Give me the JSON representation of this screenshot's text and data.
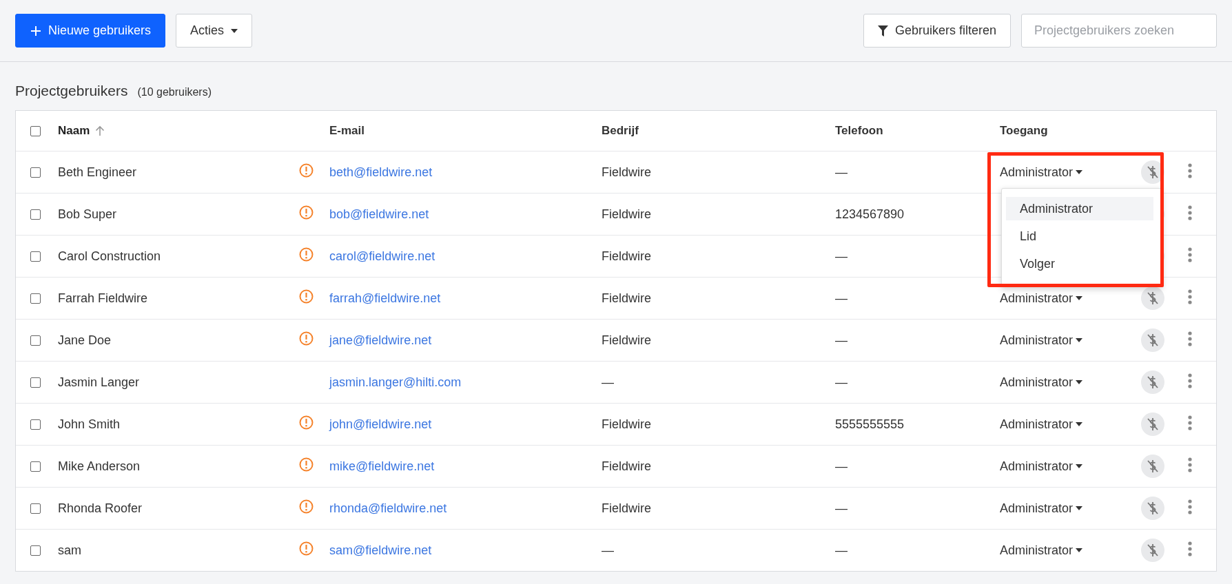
{
  "toolbar": {
    "new_button": "Nieuwe gebruikers",
    "actions_button": "Acties",
    "filter_button": "Gebruikers filteren",
    "search": {
      "placeholder": "Projectgebruikers zoeken"
    }
  },
  "heading": {
    "title": "Projectgebruikers",
    "count": "(10 gebruikers)"
  },
  "table": {
    "select_all": {
      "checked": false
    },
    "columns": [
      {
        "label": "Naam",
        "sorted": true
      },
      {
        "label": "E-mail",
        "sorted": false
      },
      {
        "label": "Bedrijf",
        "sorted": false
      },
      {
        "label": "Telefoon",
        "sorted": false
      },
      {
        "label": "Toegang",
        "sorted": false
      }
    ],
    "rows": [
      {
        "checked": false,
        "name": "Beth Engineer",
        "warning": true,
        "email": "beth@fieldwire.net",
        "company": "Fieldwire",
        "phone": "—",
        "access": "Administrator",
        "access_menu": [
          {
            "label": "Administrator",
            "selected": true
          },
          {
            "label": "Lid",
            "selected": false
          },
          {
            "label": "Volger",
            "selected": false
          }
        ]
      },
      {
        "checked": false,
        "name": "Bob Super",
        "warning": true,
        "email": "bob@fieldwire.net",
        "company": "Fieldwire",
        "phone": "1234567890"
      },
      {
        "checked": false,
        "name": "Carol Construction",
        "warning": true,
        "email": "carol@fieldwire.net",
        "company": "Fieldwire",
        "phone": "—"
      },
      {
        "checked": false,
        "name": "Farrah Fieldwire",
        "warning": true,
        "email": "farrah@fieldwire.net",
        "company": "Fieldwire",
        "phone": "—",
        "access": "Administrator"
      },
      {
        "checked": false,
        "name": "Jane Doe",
        "warning": true,
        "email": "jane@fieldwire.net",
        "company": "Fieldwire",
        "phone": "—",
        "access": "Administrator"
      },
      {
        "checked": false,
        "name": "Jasmin Langer",
        "warning": false,
        "email": "jasmin.langer@hilti.com",
        "company": "—",
        "phone": "—",
        "access": "Administrator"
      },
      {
        "checked": false,
        "name": "John Smith",
        "warning": true,
        "email": "john@fieldwire.net",
        "company": "Fieldwire",
        "phone": "5555555555",
        "access": "Administrator"
      },
      {
        "checked": false,
        "name": "Mike Anderson",
        "warning": true,
        "email": "mike@fieldwire.net",
        "company": "Fieldwire",
        "phone": "—",
        "access": "Administrator"
      },
      {
        "checked": false,
        "name": "Rhonda Roofer",
        "warning": true,
        "email": "rhonda@fieldwire.net",
        "company": "Fieldwire",
        "phone": "—",
        "access": "Administrator"
      },
      {
        "checked": false,
        "name": "sam",
        "warning": true,
        "email": "sam@fieldwire.net",
        "company": "—",
        "phone": "—",
        "access": "Administrator"
      }
    ]
  }
}
